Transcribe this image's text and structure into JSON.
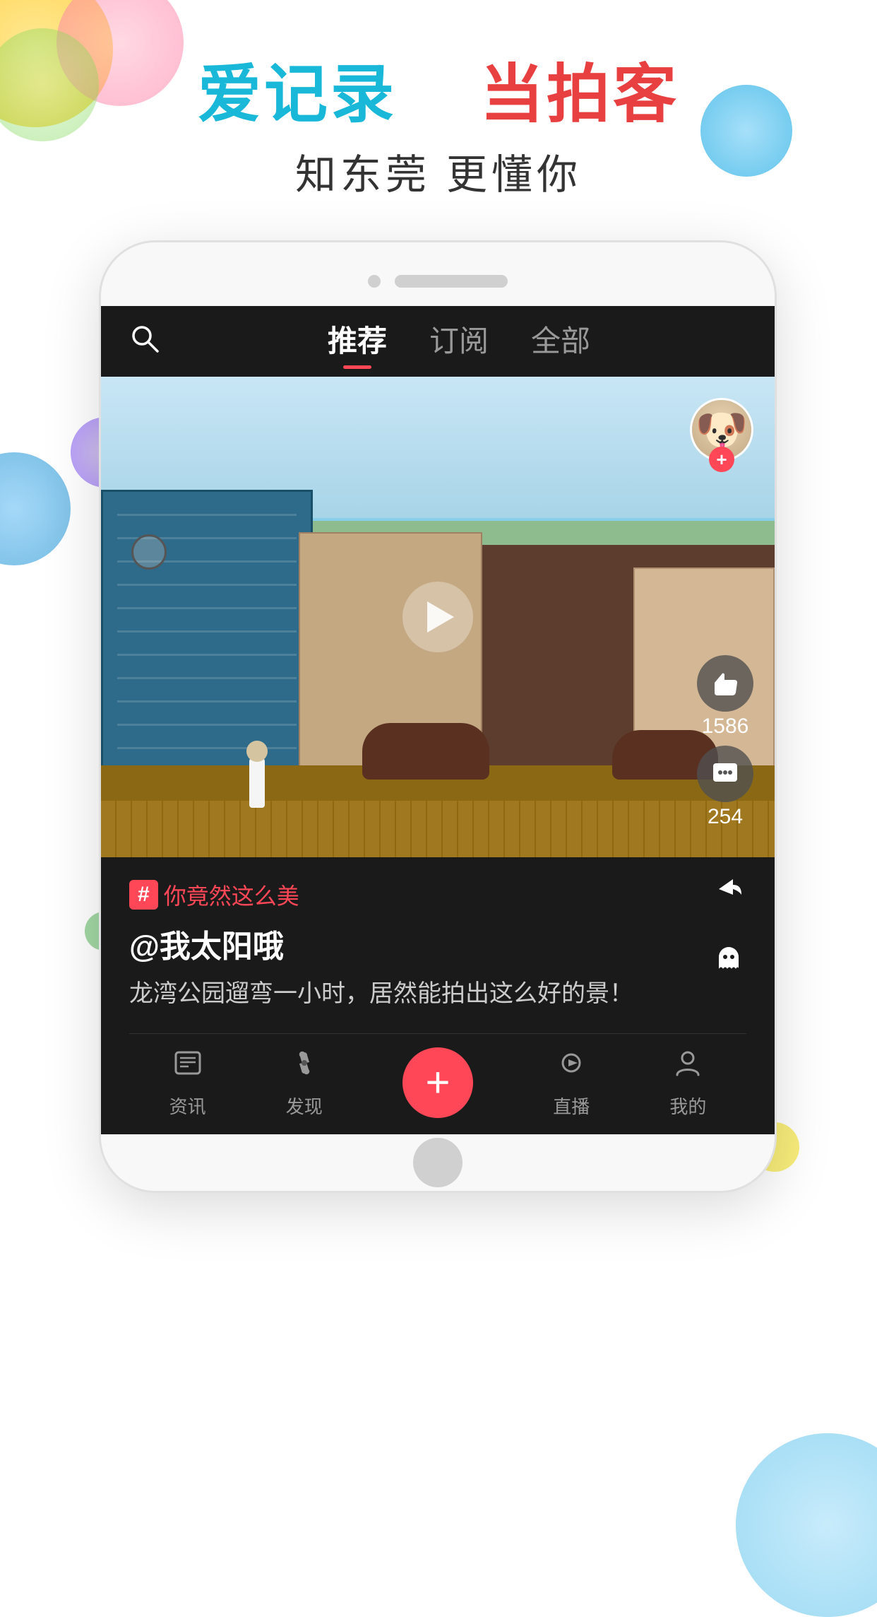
{
  "app": {
    "slogan_left": "爱记录",
    "slogan_right": "当拍客",
    "sub_slogan": "知东莞  更懂你"
  },
  "nav": {
    "tabs": [
      {
        "id": "recommend",
        "label": "推荐",
        "active": true
      },
      {
        "id": "subscribe",
        "label": "订阅",
        "active": false
      },
      {
        "id": "all",
        "label": "全部",
        "active": false
      }
    ]
  },
  "video": {
    "likes": "1586",
    "comments": "254",
    "tag": "你竟然这么美",
    "author": "@我太阳哦",
    "description": "龙湾公园遛弯一小时，居然能拍出这么好的景！"
  },
  "bottom_nav": [
    {
      "id": "news",
      "label": "资讯",
      "icon": "📰"
    },
    {
      "id": "discover",
      "label": "发现",
      "icon": "🔍"
    },
    {
      "id": "add",
      "label": "+",
      "icon": "+"
    },
    {
      "id": "live",
      "label": "直播",
      "icon": "▶"
    },
    {
      "id": "mine",
      "label": "我的",
      "icon": "👤"
    }
  ],
  "icons": {
    "search": "🔍",
    "like": "👍",
    "comment": "💬",
    "share": "↗",
    "ghost": "👻",
    "hash": "#",
    "plus": "+"
  }
}
